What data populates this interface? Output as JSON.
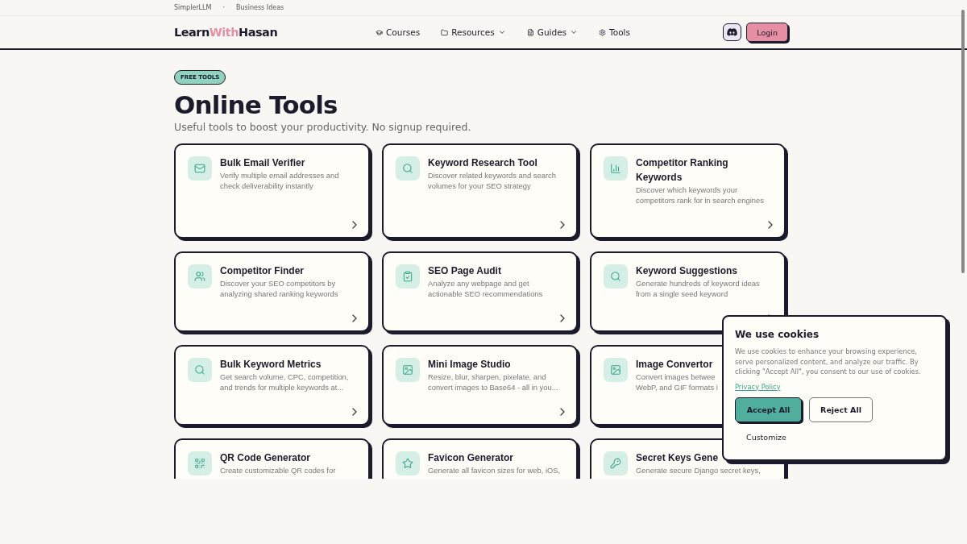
{
  "top_links": [
    "SimplerLLM",
    "·",
    "Business Ideas"
  ],
  "logo": {
    "part_1": "Learn",
    "part_2": "With",
    "part_3": "Hasan"
  },
  "nav": [
    {
      "label": "Courses",
      "dropdown": false
    },
    {
      "label": "Resources",
      "dropdown": true
    },
    {
      "label": "Guides",
      "dropdown": true
    },
    {
      "label": "Tools",
      "dropdown": false
    }
  ],
  "login": "Login",
  "badge": "FREE TOOLS",
  "title": "Online Tools",
  "subtitle": "Useful tools to boost your productivity. No signup required.",
  "tools": [
    {
      "title": "Bulk Email Verifier",
      "description": "Verify multiple email addresses and check deliverability instantly"
    },
    {
      "title": "Keyword Research Tool",
      "description": "Discover related keywords and search volumes for your SEO strategy"
    },
    {
      "title": "Competitor Ranking Keywords",
      "description": "Discover which keywords your competitors rank for in search engines"
    },
    {
      "title": "Competitor Finder",
      "description": "Discover your SEO competitors by analyzing shared ranking keywords"
    },
    {
      "title": "SEO Page Audit",
      "description": "Analyze any webpage and get actionable SEO recommendations"
    },
    {
      "title": "Keyword Suggestions",
      "description": "Generate hundreds of keyword ideas from a single seed keyword"
    },
    {
      "title": "Bulk Keyword Metrics",
      "description": "Get search volume, CPC, competition, and trends for multiple keywords at..."
    },
    {
      "title": "Mini Image Studio",
      "description": "Resize, blur, sharpen, pixelate, and convert images to Base64 - all in you..."
    },
    {
      "title": "Image Convertor",
      "description": "Convert images betwee\nWebP, and GIF formats i"
    },
    {
      "title": "QR Code Generator",
      "description": "Create customizable QR codes for"
    },
    {
      "title": "Favicon Generator",
      "description": "Generate all favicon sizes for web, iOS,"
    },
    {
      "title": "Secret Keys Gene",
      "description": "Generate secure Django secret keys,"
    }
  ],
  "cookie_banner": {
    "title": "We use cookies",
    "text": "We use cookies to enhance your browsing experience, serve personalized content, and analyze our traffic. By clicking \"Accept All\", you consent to our use of cookies.",
    "link": "Privacy Policy",
    "accept": "Accept All",
    "reject": "Reject All",
    "customize": "Customize"
  }
}
